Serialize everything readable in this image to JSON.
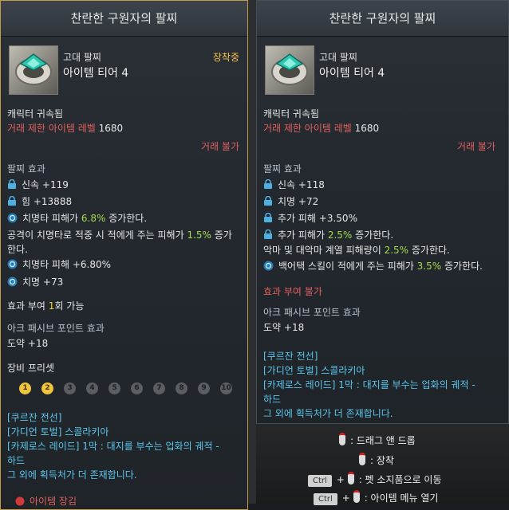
{
  "panel1": {
    "title": "찬란한 구원자의 팔찌",
    "grade": "고대 팔찌",
    "tier": "아이템 티어 4",
    "equipped": "장착중",
    "bound": "캐릭터 귀속됨",
    "trade_limit_label": "거래 제한 아이템 레벨",
    "trade_limit_value": "1680",
    "trade_status": "거래 불가",
    "effects_title": "팔찌 효과",
    "effects": {
      "e1": "신속 +119",
      "e2": "힘 +13888",
      "e3_a": "치명타 피해가 ",
      "e3_b": "6.8%",
      "e3_c": " 증가한다.",
      "e4_a": "공격이 치명타로 적중 시 적에게 주는 피해가 ",
      "e4_b": "1.5%",
      "e4_c": " 증가",
      "e4_d": "한다.",
      "e5": "치명타 피해 +6.80%",
      "e6": "치명 +73"
    },
    "grant_a": "효과 부여 ",
    "grant_b": "1",
    "grant_c": "회 가능",
    "ark_title": "아크 패시브 포인트 효과",
    "ark_value": "도약 +18",
    "preset_title": "장비 프리셋",
    "presets": [
      "1",
      "2",
      "3",
      "4",
      "5",
      "6",
      "7",
      "8",
      "9",
      "10"
    ],
    "sources": {
      "s1": "[쿠르잔 전선]",
      "s2": "[가디언 토벌] 스콜라키아",
      "s3": "[카제로스 레이드] 1막 : 대지를 부수는 업화의 궤적 -",
      "s4": "하드",
      "s5": "그 외에 획득처가 더 존재합니다."
    },
    "bottom_warning": "아이템 장김"
  },
  "panel2": {
    "title": "찬란한 구원자의 팔찌",
    "grade": "고대 팔찌",
    "tier": "아이템 티어 4",
    "bound": "캐릭터 귀속됨",
    "trade_limit_label": "거래 제한 아이템 레벨",
    "trade_limit_value": "1680",
    "trade_status": "거래 불가",
    "effects_title": "팔찌 효과",
    "effects": {
      "e1": "신속 +118",
      "e2": "치명 +72",
      "e3": "추가 피해 +3.50%",
      "e4_a": "추가 피해가 ",
      "e4_b": "2.5%",
      "e4_c": " 증가한다.",
      "e5_a": "악마 및 대악마 계열 피해량이 ",
      "e5_b": "2.5%",
      "e5_c": " 증가한다.",
      "e6_a": "백어택 스킬이 적에게 주는 피해가 ",
      "e6_b": "3.5%",
      "e6_c": " 증가한다."
    },
    "grant": "효과 부여 불가",
    "ark_title": "아크 패시브 포인트 효과",
    "ark_value": "도약 +18",
    "sources": {
      "s1": "[쿠르잔 전선]",
      "s2": "[가디언 토벌] 스콜라키아",
      "s3": "[카제로스 레이드] 1막 : 대지를 부수는 업화의 궤적 -",
      "s4": "하드",
      "s5": "그 외에 획득처가 더 존재합니다."
    }
  },
  "help": {
    "drag": ": 드래그 앤 드롭",
    "equip": ": 장착",
    "move_pet": ": 펫 소지품으로 이동",
    "item_menu": ": 아이템 메뉴 열기",
    "ctrl1": "Ctrl",
    "ctrl2": "Ctrl",
    "plus": "+"
  },
  "colors": {
    "trade_red": "#e0605e",
    "equipped_gold": "#f2c14e",
    "effect_green": "#a6da4c",
    "source_blue": "#5cc6ec",
    "preset_yellow": "#f0c53c"
  },
  "icons": {
    "lock": "lock-icon",
    "effect": "engraving-effect-icon",
    "bracelet": "bracelet-item-icon",
    "mouse": "mouse-button-icon"
  }
}
